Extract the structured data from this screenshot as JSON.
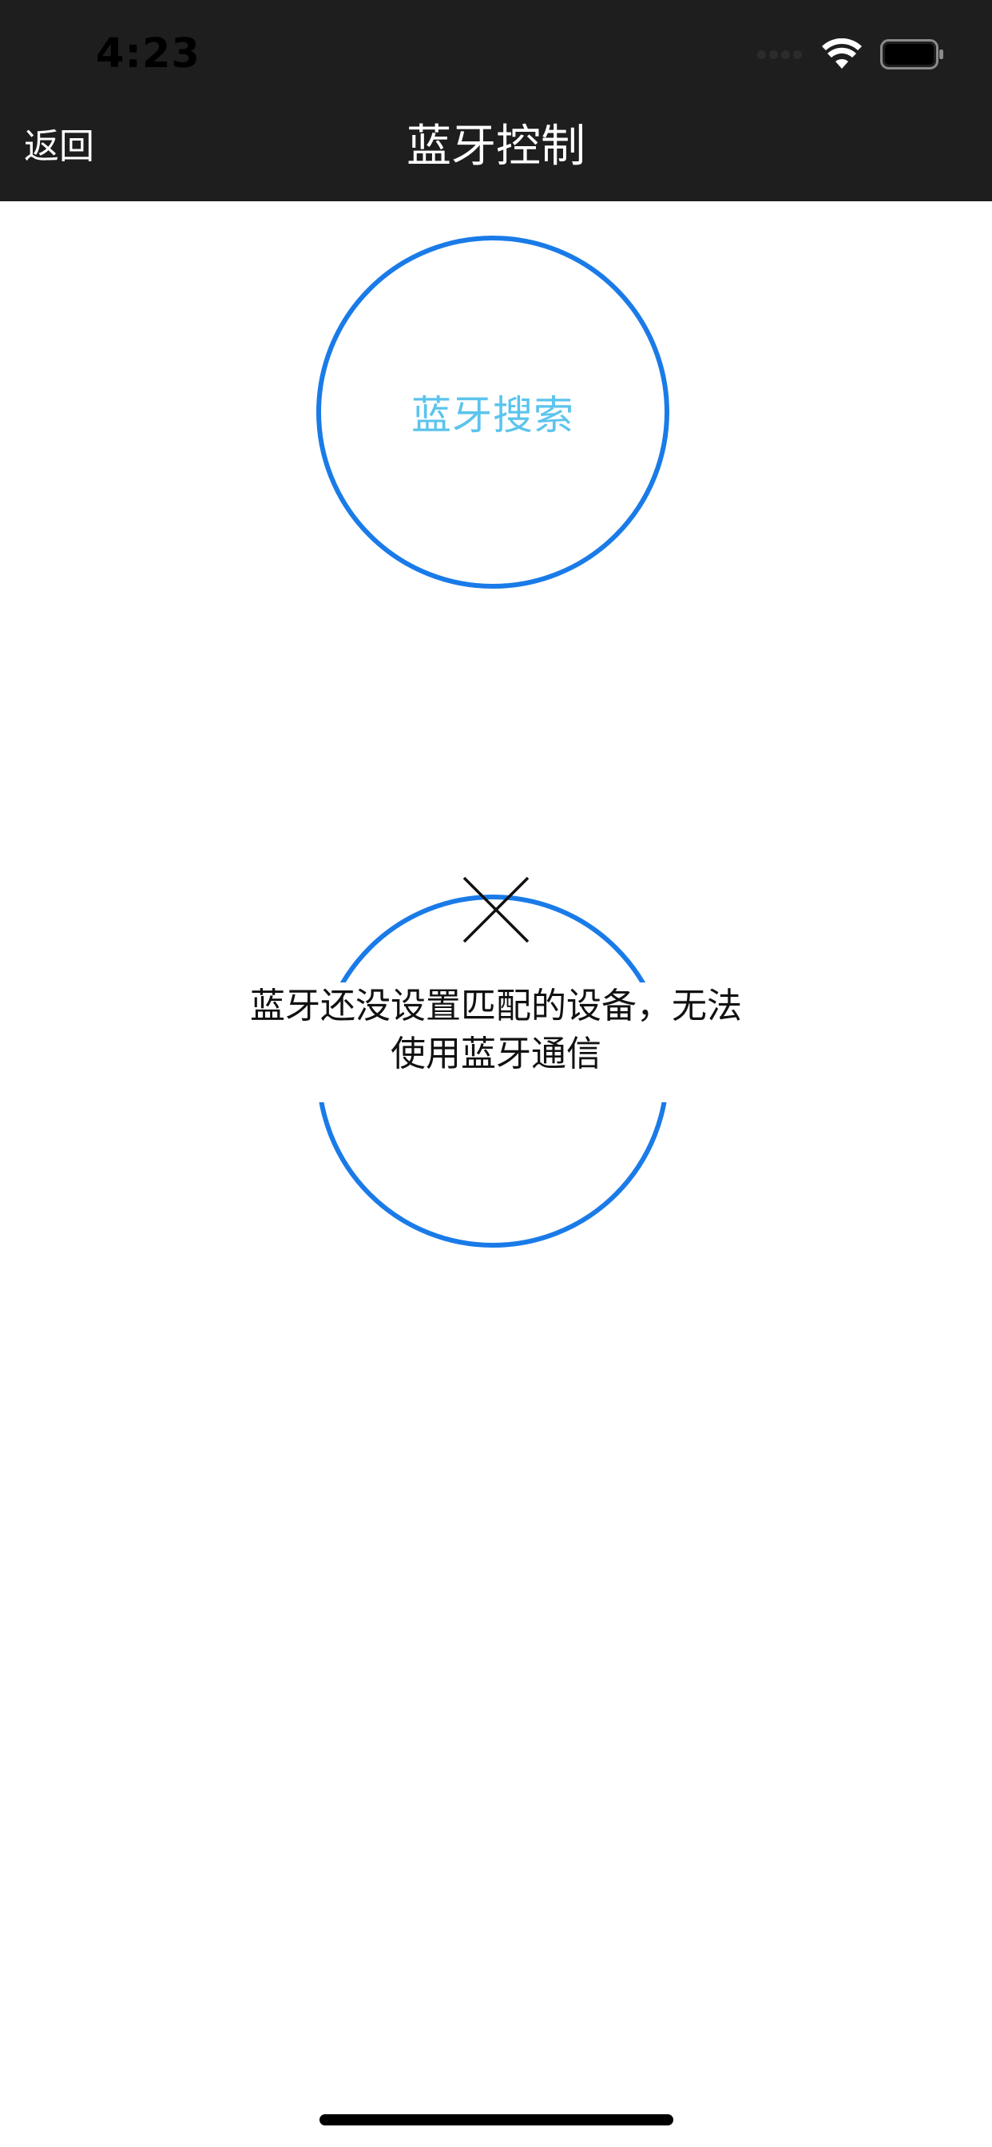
{
  "status_bar": {
    "time": "4:23"
  },
  "nav": {
    "back_label": "返回",
    "title": "蓝牙控制"
  },
  "bluetooth": {
    "search_label": "蓝牙搜索",
    "message": "蓝牙还没设置匹配的设备，无法使用蓝牙通信"
  },
  "icons": {
    "close": "close-icon",
    "wifi": "wifi-icon",
    "battery": "battery-icon"
  },
  "colors": {
    "nav_background": "#1e1e1e",
    "circle_border": "#1a7be8",
    "search_text": "#5bc4ec"
  }
}
